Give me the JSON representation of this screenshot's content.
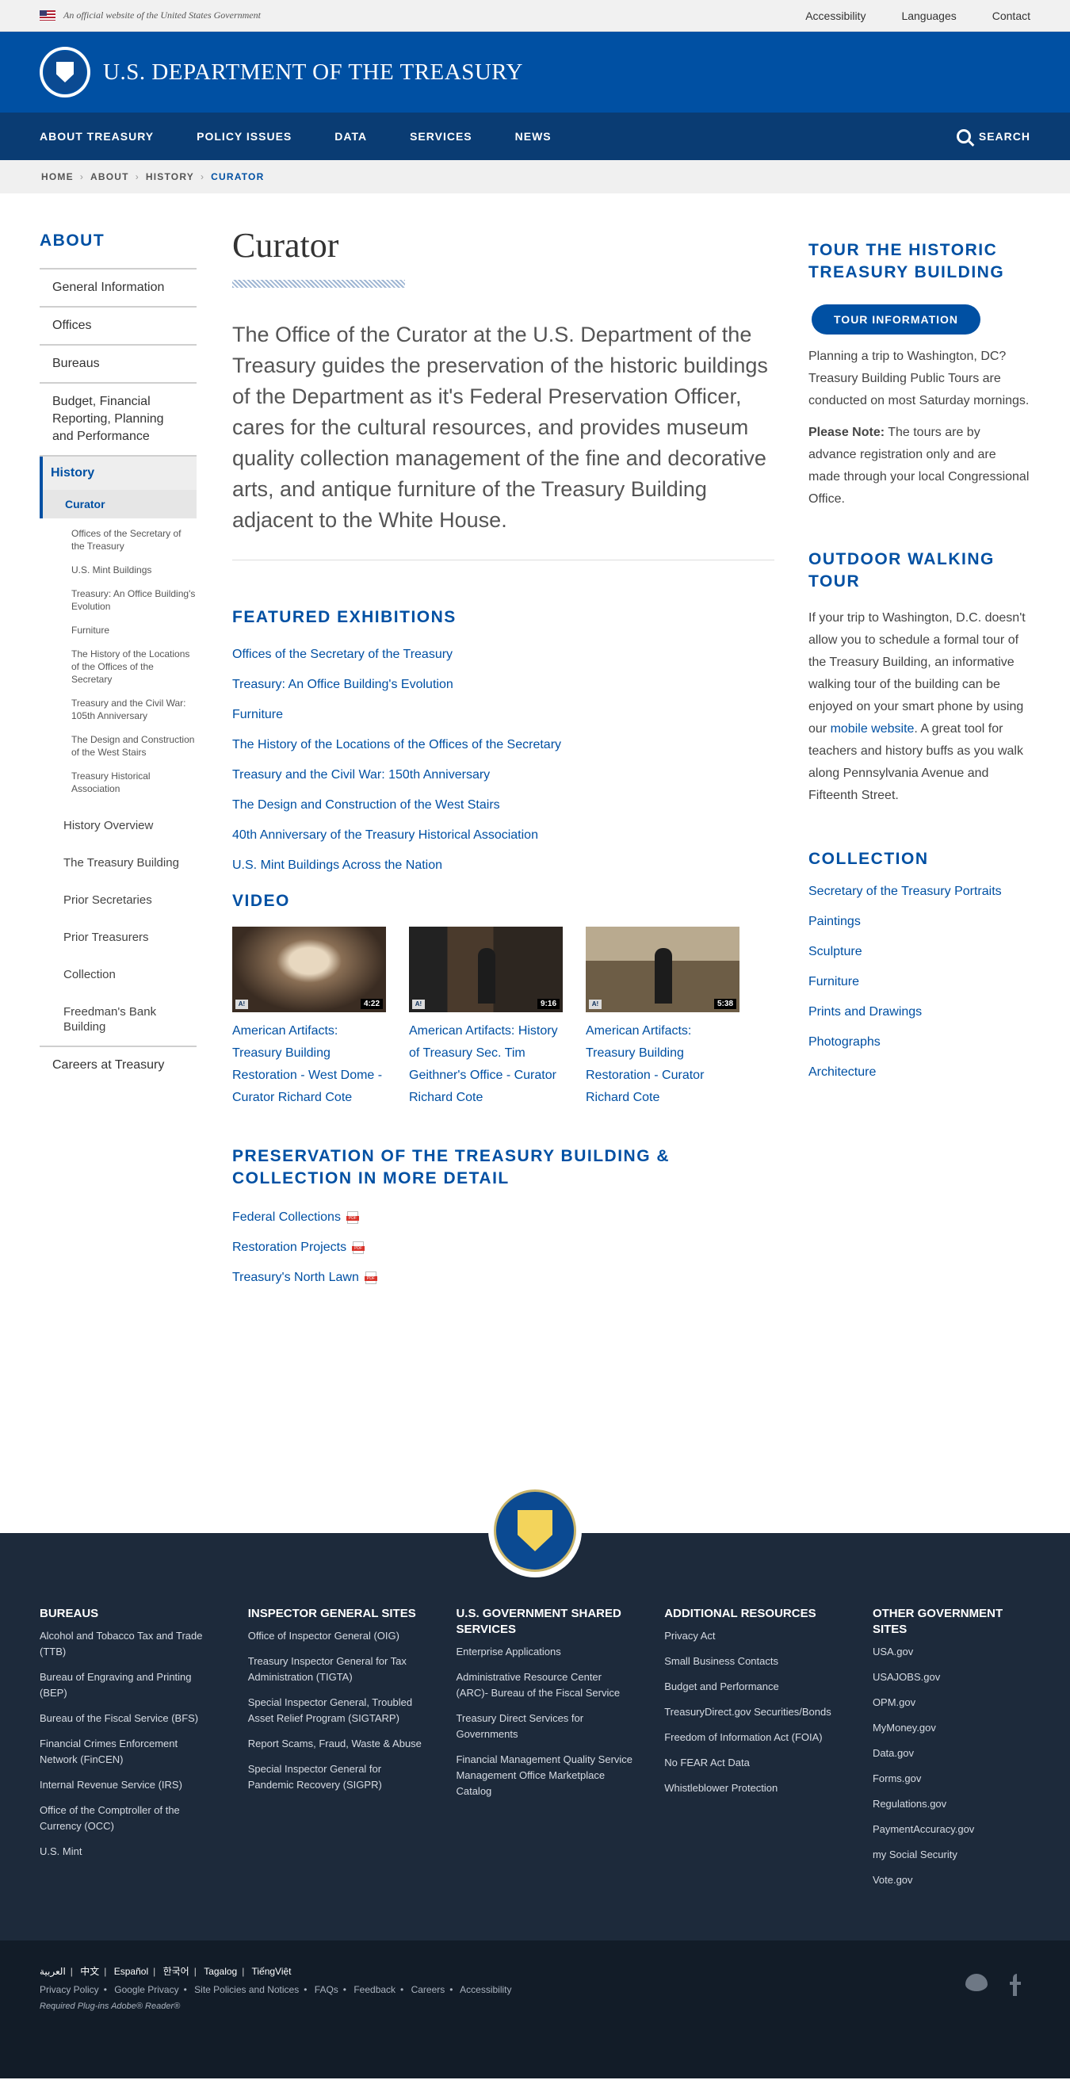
{
  "gov_banner": {
    "text": "An official website of the United States Government",
    "links": [
      "Accessibility",
      "Languages",
      "Contact"
    ]
  },
  "header": {
    "title": "U.S. DEPARTMENT OF THE TREASURY"
  },
  "nav": {
    "items": [
      "ABOUT TREASURY",
      "POLICY ISSUES",
      "DATA",
      "SERVICES",
      "NEWS"
    ],
    "search": "SEARCH"
  },
  "breadcrumb": [
    "HOME",
    "ABOUT",
    "HISTORY",
    "CURATOR"
  ],
  "sidebar": {
    "title": "ABOUT",
    "items": [
      "General Information",
      "Offices",
      "Bureaus",
      "Budget, Financial Reporting, Planning and Performance"
    ],
    "history": "History",
    "curator": "Curator",
    "curator_sub": [
      "Offices of the Secretary of the Treasury",
      "U.S. Mint Buildings",
      "Treasury: An Office Building's Evolution",
      "Furniture",
      "The History of the Locations of the Offices of the Secretary",
      "Treasury and the Civil War: 105th Anniversary",
      "The Design and Construction of the West Stairs",
      "Treasury Historical Association"
    ],
    "history_sub": [
      "History Overview",
      "The Treasury Building",
      "Prior Secretaries",
      "Prior Treasurers",
      "Collection",
      "Freedman's Bank Building"
    ],
    "careers": "Careers at Treasury"
  },
  "main": {
    "title": "Curator",
    "lead": "The Office of the Curator at the U.S. Department of the Treasury guides the preservation of the historic buildings of the Department as it's Federal Preservation Officer, cares for the cultural resources, and provides museum quality collection management of the fine and decorative arts, and antique furniture of the Treasury Building adjacent to the White House.",
    "featured_heading": "FEATURED EXHIBITIONS",
    "featured": [
      "Offices of the Secretary of the Treasury",
      "Treasury: An Office Building's Evolution",
      "Furniture",
      "The History of the Locations of the Offices of the Secretary",
      "Treasury and the Civil War: 150th Anniversary",
      "The Design and Construction of the West Stairs",
      "40th Anniversary of the Treasury Historical Association",
      "U.S. Mint Buildings Across the Nation"
    ],
    "video_heading": "VIDEO",
    "videos": [
      {
        "duration": "4:22",
        "badge": "A!",
        "title": "American Artifacts: Treasury Building Restoration - West Dome - Curator Richard Cote"
      },
      {
        "duration": "9:16",
        "badge": "A!",
        "title": "American Artifacts: History of Treasury Sec. Tim Geithner's Office - Curator Richard Cote"
      },
      {
        "duration": "5:38",
        "badge": "A!",
        "title": "American Artifacts: Treasury Building Restoration - Curator Richard Cote"
      }
    ],
    "preservation_heading": "PRESERVATION OF THE TREASURY BUILDING & COLLECTION IN MORE DETAIL",
    "preservation": [
      "Federal Collections",
      "Restoration Projects",
      "Treasury's North Lawn"
    ]
  },
  "right": {
    "tour_heading": "TOUR THE HISTORIC TREASURY BUILDING",
    "tour_button": "TOUR INFORMATION",
    "tour_text": "Planning a trip to Washington, DC? Treasury Building Public Tours are conducted on most Saturday mornings.",
    "note_label": "Please Note:",
    "note_text": " The tours are by advance registration only and are made through your local Congressional Office.",
    "walking_heading": "OUTDOOR WALKING TOUR",
    "walking_text_1": "If your trip to Washington, D.C. doesn't allow you to schedule a formal tour of the Treasury Building, an informative walking tour of the building can be enjoyed on your smart phone by using our ",
    "walking_link": "mobile website",
    "walking_text_2": ". A great tool for teachers and history buffs as you walk along Pennsylvania Avenue and Fifteenth Street.",
    "collection_heading": "COLLECTION",
    "collection": [
      "Secretary of the Treasury Portraits",
      "Paintings",
      "Sculpture",
      "Furniture",
      "Prints and Drawings",
      "Photographs",
      "Architecture"
    ]
  },
  "footer": {
    "columns": [
      {
        "heading": "BUREAUS",
        "links": [
          "Alcohol and Tobacco Tax and Trade (TTB)",
          "Bureau of Engraving and Printing (BEP)",
          "Bureau of the Fiscal Service (BFS)",
          "Financial Crimes Enforcement Network (FinCEN)",
          "Internal Revenue Service (IRS)",
          "Office of the Comptroller of the Currency (OCC)",
          "U.S. Mint"
        ]
      },
      {
        "heading": "INSPECTOR GENERAL SITES",
        "links": [
          "Office of Inspector General (OIG)",
          "Treasury Inspector General for Tax Administration (TIGTA)",
          "Special Inspector General, Troubled Asset Relief Program (SIGTARP)",
          "Report Scams, Fraud, Waste & Abuse",
          "Special Inspector General for Pandemic Recovery (SIGPR)"
        ]
      },
      {
        "heading": "U.S. GOVERNMENT SHARED SERVICES",
        "links": [
          "Enterprise Applications",
          "Administrative Resource Center (ARC)- Bureau of the Fiscal Service",
          "Treasury Direct Services for Governments",
          "Financial Management Quality Service Management Office Marketplace Catalog"
        ]
      },
      {
        "heading": "ADDITIONAL RESOURCES",
        "links": [
          "Privacy Act",
          "Small Business Contacts",
          "Budget and Performance",
          "TreasuryDirect.gov Securities/Bonds",
          "Freedom of Information Act (FOIA)",
          "No FEAR Act Data",
          "Whistleblower Protection"
        ]
      },
      {
        "heading": "OTHER GOVERNMENT SITES",
        "links": [
          "USA.gov",
          "USAJOBS.gov",
          "OPM.gov",
          "MyMoney.gov",
          "Data.gov",
          "Forms.gov",
          "Regulations.gov",
          "PaymentAccuracy.gov",
          "my Social Security",
          "Vote.gov"
        ]
      }
    ],
    "languages": [
      "العربية",
      "中文",
      "Español",
      "한국어",
      "Tagalog",
      "TiếngViệt"
    ],
    "policies": [
      "Privacy Policy",
      "Google Privacy",
      "Site Policies and Notices",
      "FAQs",
      "Feedback",
      "Careers",
      "Accessibility"
    ],
    "plugins": "Required Plug-ins  Adobe® Reader®"
  }
}
